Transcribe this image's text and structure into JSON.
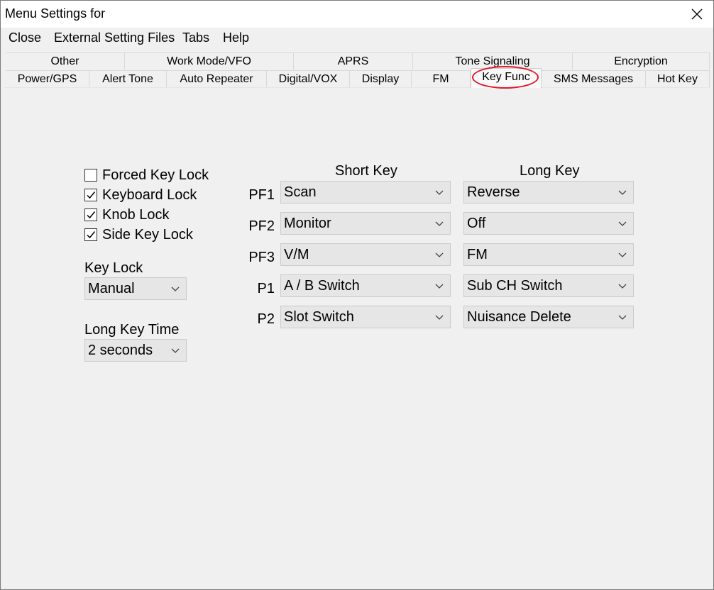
{
  "window": {
    "title": "Menu Settings for"
  },
  "menubar": [
    "Close",
    "External Setting Files",
    "Tabs",
    "Help"
  ],
  "tabs": {
    "row1": [
      "Other",
      "Work Mode/VFO",
      "APRS",
      "Tone Signaling",
      "Encryption"
    ],
    "row2": [
      "Power/GPS",
      "Alert Tone",
      "Auto Repeater",
      "Digital/VOX",
      "Display",
      "FM",
      "Key Func",
      "SMS Messages",
      "Hot Key"
    ],
    "active": "Key Func",
    "highlight_color": "#e4162b"
  },
  "locks": {
    "items": [
      {
        "label": "Forced Key Lock",
        "checked": false
      },
      {
        "label": "Keyboard Lock",
        "checked": true
      },
      {
        "label": "Knob Lock",
        "checked": true
      },
      {
        "label": "Side Key Lock",
        "checked": true
      }
    ]
  },
  "key_lock": {
    "label": "Key Lock",
    "value": "Manual"
  },
  "long_key_time": {
    "label": "Long Key Time",
    "value": "2 seconds"
  },
  "keys": {
    "short_header": "Short Key",
    "long_header": "Long Key",
    "rows": [
      {
        "key": "PF1",
        "short": "Scan",
        "long": "Reverse"
      },
      {
        "key": "PF2",
        "short": "Monitor",
        "long": "Off"
      },
      {
        "key": "PF3",
        "short": "V/M",
        "long": "FM"
      },
      {
        "key": "P1",
        "short": "A / B Switch",
        "long": "Sub CH Switch"
      },
      {
        "key": "P2",
        "short": "Slot Switch",
        "long": "Nuisance Delete"
      }
    ]
  }
}
